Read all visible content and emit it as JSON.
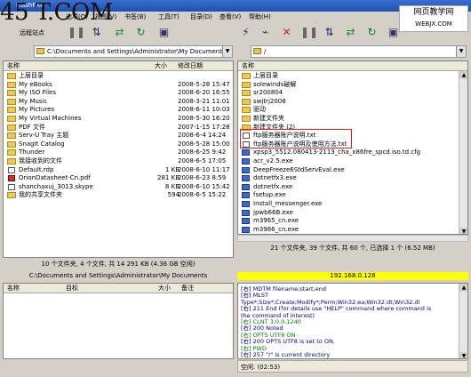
{
  "window": {
    "title": "FlashFXP"
  },
  "watermark": {
    "left": "45 T.COM",
    "right_line1": "网页教学网",
    "right_line2": "WEBJX.COM"
  },
  "menu": [
    {
      "label": "选项(O)"
    },
    {
      "label": "视图(V)"
    },
    {
      "label": "书签(B)"
    },
    {
      "label": "工具(T)"
    },
    {
      "label": "目录(D)"
    },
    {
      "label": "查看(V)"
    },
    {
      "label": "帮助(H)"
    }
  ],
  "left_toolbar_label": "远程站点",
  "left_path": "C:\\Documents and Settings\\Administrator\\My Documents",
  "right_path": "/",
  "left_columns": {
    "name": "名称",
    "size": "大小",
    "date": "修改日期"
  },
  "right_columns": {
    "name": "名称"
  },
  "left_files": [
    {
      "icon": "up",
      "name": "上层目录",
      "size": "",
      "date": ""
    },
    {
      "icon": "folder",
      "name": "My eBooks",
      "size": "",
      "date": "2008-5-28 15:47"
    },
    {
      "icon": "folder",
      "name": "My ISO Files",
      "size": "",
      "date": "2008-6-20 16:55"
    },
    {
      "icon": "folder",
      "name": "My Music",
      "size": "",
      "date": "2008-3-21 11:01"
    },
    {
      "icon": "folder",
      "name": "My Pictures",
      "size": "",
      "date": "2008-6-11 10:03"
    },
    {
      "icon": "folder",
      "name": "My Virtual Machines",
      "size": "",
      "date": "2008-5-30 16:20"
    },
    {
      "icon": "folder",
      "name": "PDF 文件",
      "size": "",
      "date": "2007-1-15 17:28"
    },
    {
      "icon": "folder",
      "name": "Serv-U Tray 主题",
      "size": "",
      "date": "2008-6-4 14:24"
    },
    {
      "icon": "folder",
      "name": "SnagIt Catalog",
      "size": "",
      "date": "2008-5-28 15:00"
    },
    {
      "icon": "folder",
      "name": "Thunder",
      "size": "",
      "date": "2008-6-25 9:42"
    },
    {
      "icon": "folder",
      "name": "我接收到的文件",
      "size": "",
      "date": "2008-6-5 17:05"
    },
    {
      "icon": "file",
      "name": "Default.rdp",
      "size": "1 KB",
      "date": "2008-6-10 11:17"
    },
    {
      "icon": "pdf",
      "name": "OrionDatasheet-Cn.pdf",
      "size": "281 KB",
      "date": "2008-6-23 8:59"
    },
    {
      "icon": "file",
      "name": "shanchaxuj_3013.skype",
      "size": "8 KB",
      "date": "2008-6-10 15:42"
    },
    {
      "icon": "folder",
      "name": "我的共享文件夹",
      "size": "594",
      "date": "2008-6-5 15:22"
    }
  ],
  "right_files": [
    {
      "icon": "up",
      "name": "上层目录"
    },
    {
      "icon": "folder",
      "name": "solewinds破解"
    },
    {
      "icon": "folder",
      "name": "sr200804"
    },
    {
      "icon": "folder",
      "name": "swjtrj2008"
    },
    {
      "icon": "folder",
      "name": "驱动"
    },
    {
      "icon": "folder",
      "name": "新建文件夹"
    },
    {
      "icon": "folder",
      "name": "新建文件夹 (2)"
    },
    {
      "icon": "file",
      "name": "ftp服务器账户说明.txt"
    },
    {
      "icon": "file",
      "name": "ftp服务器账户说明及使用方法.txt"
    },
    {
      "icon": "exe",
      "name": "xpsp3_5512.080413-2113_cha_x86fre_spcd.iso.td.cfg"
    },
    {
      "icon": "exe",
      "name": "acr_v2.5.exe"
    },
    {
      "icon": "exe",
      "name": "DeepFreeze6StdServEval.exe"
    },
    {
      "icon": "exe",
      "name": "dotnetfx3.exe"
    },
    {
      "icon": "exe",
      "name": "dotnetfx.exe"
    },
    {
      "icon": "exe",
      "name": "fsetup.exe"
    },
    {
      "icon": "exe",
      "name": "Install_messenger.exe"
    },
    {
      "icon": "exe",
      "name": "jpwb66B.exe"
    },
    {
      "icon": "exe",
      "name": "m3965_cn.exe"
    },
    {
      "icon": "exe",
      "name": "m3966_cn.exe"
    }
  ],
  "left_status": "10 个文件夹, 4 个文件, 共 14 291 KB (4.36 GB 空闲)",
  "right_status": "21 个文件夹, 39 个文件, 共 60 个, 已选择 1 个 (6.52 MB)",
  "left_status2": "C:\\Documents and Settings\\Administrator\\My Documents",
  "right_ip": "192.168.0.128",
  "queue_columns": {
    "name": "名称",
    "target": "目标",
    "size": "大小",
    "note": "备注"
  },
  "log": [
    {
      "text": "[右]     MDTM filename;start;end",
      "green": false
    },
    {
      "text": "[右]     MLST",
      "green": false
    },
    {
      "text": "Type*;Size*;Create;Modify*;Perm;Win32.ea;Win32.dt;Win32.dl",
      "green": false
    },
    {
      "text": "[右] 211 End (for details use \"HELP\" command where command is",
      "green": false
    },
    {
      "text": "the command of interest)",
      "green": false
    },
    {
      "text": "[右] CLNT 3.0.0.1240",
      "green": true
    },
    {
      "text": "[右] 200 Noted",
      "green": false
    },
    {
      "text": "[右] OPTS UTF8 ON",
      "green": true
    },
    {
      "text": "[右] 200 OPTS UTF8 is set to ON.",
      "green": false
    },
    {
      "text": "[右] PWD",
      "green": true
    },
    {
      "text": "[右] 257 \"/\" is current directory",
      "green": false
    }
  ],
  "bottom_status": "空闲. (02:53)"
}
